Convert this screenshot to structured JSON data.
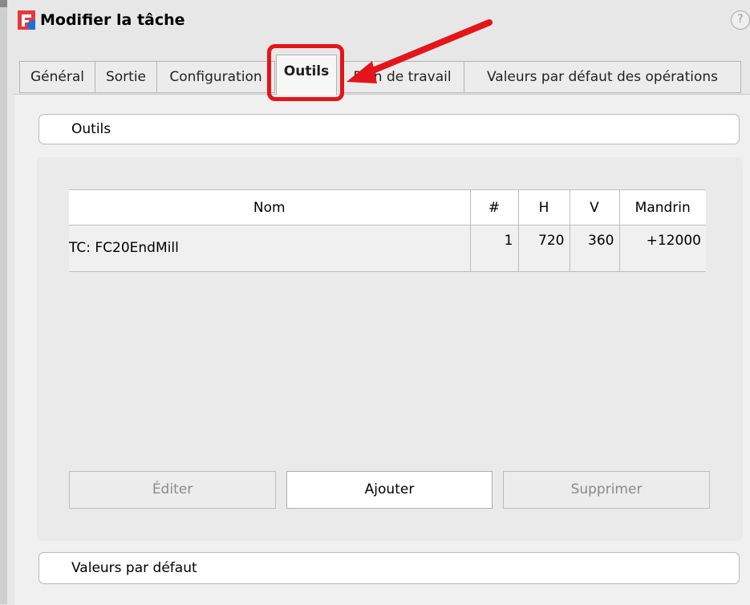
{
  "window": {
    "title": "Modifier la tâche",
    "help_icon": "?"
  },
  "tabs": [
    {
      "label": "Général"
    },
    {
      "label": "Sortie"
    },
    {
      "label": "Configuration"
    },
    {
      "label": "Outils",
      "active": true
    },
    {
      "label": "Plan de travail"
    },
    {
      "label": "Valeurs par défaut des opérations"
    }
  ],
  "tools_section": {
    "header": "Outils",
    "table": {
      "columns": [
        "Nom",
        "#",
        "H",
        "V",
        "Mandrin"
      ],
      "rows": [
        {
          "name": "TC: FC20EndMill",
          "number": "1",
          "h": "720",
          "v": "360",
          "spindle": "+12000"
        }
      ]
    },
    "buttons": {
      "edit": "Éditer",
      "add": "Ajouter",
      "delete": "Supprimer"
    }
  },
  "defaults_section": {
    "header": "Valeurs par défaut"
  },
  "colors": {
    "highlight": "#e3151a",
    "app_icon": "#e43a3a",
    "app_icon_accent": "#1e6fd8"
  }
}
